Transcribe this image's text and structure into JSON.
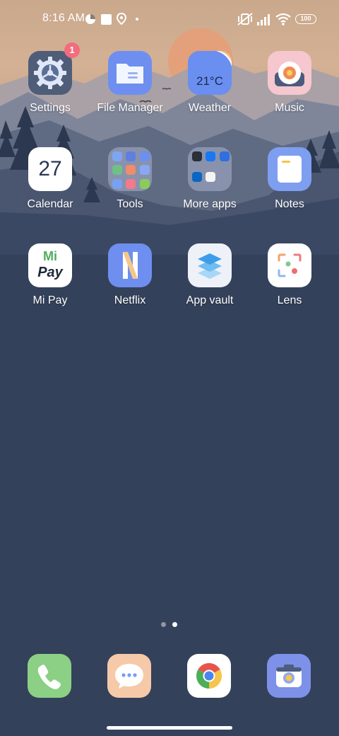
{
  "status": {
    "time": "8:16 AM",
    "battery": "100",
    "icons": [
      "data-saver-icon",
      "stop-icon",
      "location-pin-icon",
      "dot-icon",
      "mute-icon",
      "signal-icon",
      "wifi-icon",
      "battery-icon"
    ]
  },
  "apps": [
    {
      "label": "Settings",
      "icon": "settings-gear-icon",
      "badge": "1"
    },
    {
      "label": "File Manager",
      "icon": "folder-icon"
    },
    {
      "label": "Weather",
      "icon": "weather-icon",
      "temp": "21°C"
    },
    {
      "label": "Music",
      "icon": "music-record-icon"
    },
    {
      "label": "Calendar",
      "icon": "calendar-icon",
      "date": "27"
    },
    {
      "label": "Tools",
      "icon": "tools-folder-icon"
    },
    {
      "label": "More apps",
      "icon": "more-apps-folder-icon"
    },
    {
      "label": "Notes",
      "icon": "notes-icon"
    },
    {
      "label": "Mi Pay",
      "icon": "mi-pay-icon",
      "brand_top": "Mi",
      "brand_bottom": "Pay"
    },
    {
      "label": "Netflix",
      "icon": "netflix-icon",
      "letter": "N"
    },
    {
      "label": "App vault",
      "icon": "app-vault-icon"
    },
    {
      "label": "Lens",
      "icon": "lens-icon"
    }
  ],
  "dock": [
    {
      "icon": "phone-icon"
    },
    {
      "icon": "messages-icon"
    },
    {
      "icon": "chrome-icon"
    },
    {
      "icon": "camera-icon"
    }
  ],
  "pages": {
    "count": 2,
    "active": 2
  },
  "colors": {
    "accent": "#7b9cf5",
    "badge": "#f26c7d",
    "background": "#34415a"
  }
}
